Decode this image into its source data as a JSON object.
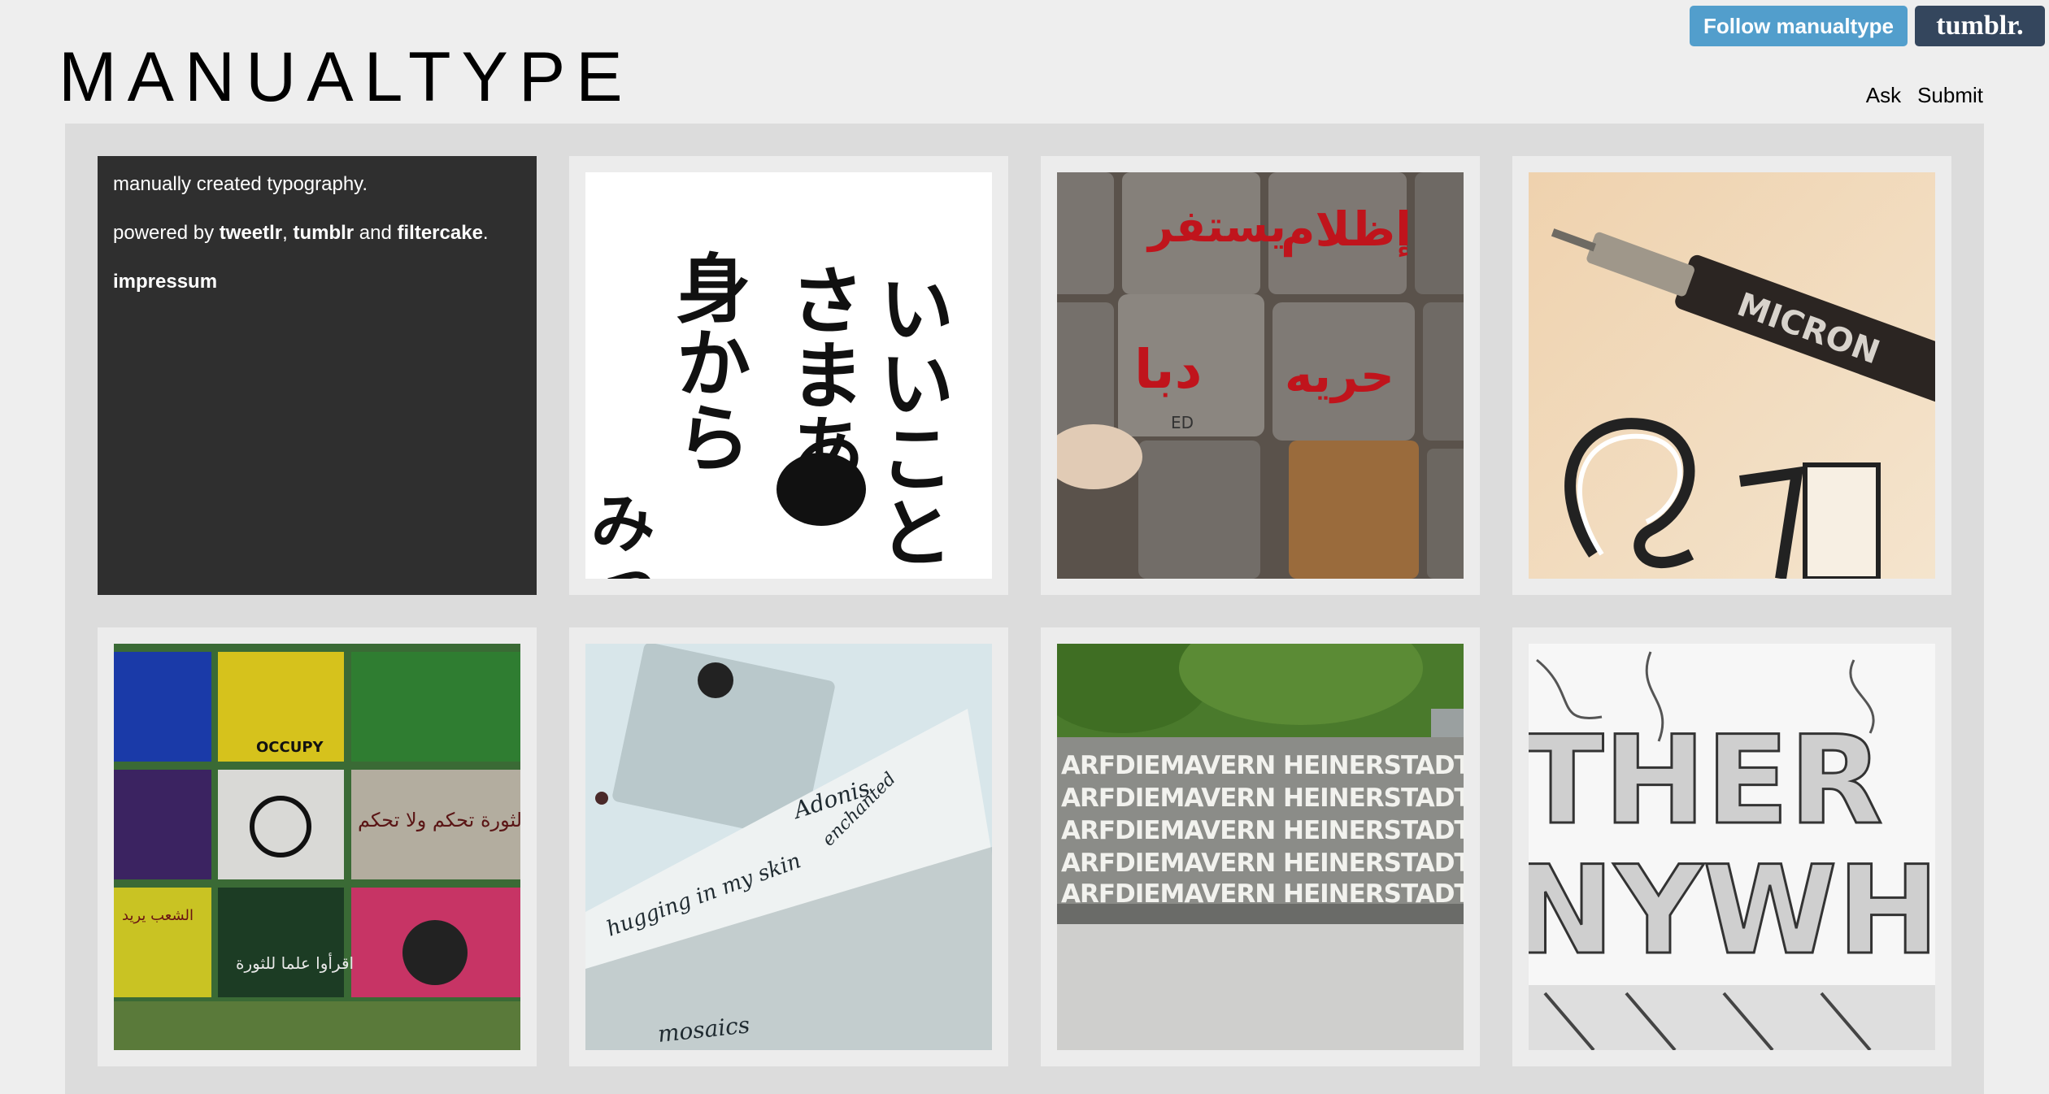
{
  "header": {
    "follow_label": "Follow manualtype",
    "tumblr_label": "tumblr.",
    "site_title": "MANUALTYPE"
  },
  "nav": {
    "ask": "Ask",
    "submit": "Submit"
  },
  "info": {
    "tagline": "manually created typography.",
    "powered_by": "powered by",
    "link_tweetlr": "tweetlr",
    "comma": ",",
    "link_tumblr": "tumblr",
    "and": "and",
    "link_filtercake": "filtercake",
    "period": ".",
    "impressum": "impressum"
  },
  "posts": [
    {
      "subject": "japanese-brush-calligraphy",
      "kana": [
        "いいこと",
        "さまあ",
        "身から",
        "みっ"
      ]
    },
    {
      "subject": "arabic-graffiti-stone-blocks",
      "text": [
        "يستفر",
        "إظلام",
        "دبا",
        "حريه",
        "ED"
      ]
    },
    {
      "subject": "micron-pen-ampersand",
      "pen_label": "MICRON"
    },
    {
      "subject": "colored-tiles-arabic",
      "tile_text": [
        "OCCUPY",
        "الثورة تحكم ولا تحكم",
        "اقرأوا علما للثورة",
        "الشعب يريد"
      ]
    },
    {
      "subject": "calligraphy-paper-scroll",
      "script": [
        "enchanted",
        "hugging in my skin",
        "Adonis",
        "mosaics"
      ]
    },
    {
      "subject": "graffiti-wall-street",
      "wall_text": [
        "ARFDIEMAVERN HEINERSTADTNICHT"
      ]
    },
    {
      "subject": "illustrated-lettering",
      "letters": [
        "THER",
        "NYWHER"
      ]
    }
  ],
  "colors": {
    "background": "#eeeeee",
    "panel": "#dcdcdc",
    "info_box": "#2f2f2f",
    "follow_button": "#529ecc",
    "tumblr_button": "#34465d"
  }
}
